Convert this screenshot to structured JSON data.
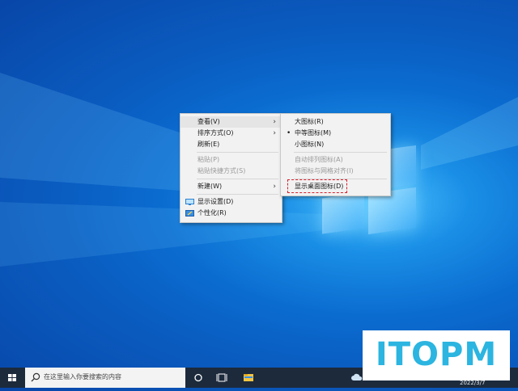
{
  "context_menu": {
    "items": [
      {
        "label": "查看(V)",
        "has_submenu": true,
        "enabled": true
      },
      {
        "label": "排序方式(O)",
        "has_submenu": true,
        "enabled": true
      },
      {
        "label": "刷新(E)",
        "enabled": true
      },
      {
        "label": "粘贴(P)",
        "enabled": false
      },
      {
        "label": "粘贴快捷方式(S)",
        "enabled": false
      },
      {
        "label": "新建(W)",
        "has_submenu": true,
        "enabled": true
      },
      {
        "label": "显示设置(D)",
        "icon": "display-icon",
        "enabled": true
      },
      {
        "label": "个性化(R)",
        "icon": "personalize-icon",
        "enabled": true
      }
    ]
  },
  "view_submenu": {
    "items": [
      {
        "label": "大图标(R)",
        "enabled": true
      },
      {
        "label": "中等图标(M)",
        "enabled": true,
        "selected": true
      },
      {
        "label": "小图标(N)",
        "enabled": true
      },
      {
        "label": "自动排列图标(A)",
        "enabled": false
      },
      {
        "label": "将图标与网格对齐(I)",
        "enabled": false
      },
      {
        "label": "显示桌面图标(D)",
        "enabled": true,
        "highlighted": true
      }
    ],
    "bullet": "•",
    "highlight_color": "#d8202a"
  },
  "taskbar": {
    "search_placeholder": "在这里输入你要搜索的内容",
    "icons": [
      "windows-start-icon",
      "search-icon",
      "cortana-circle-icon",
      "task-view-icon",
      "file-explorer-icon",
      "weather-cloud-icon"
    ],
    "clock_date": "2022/3/7"
  },
  "watermark": {
    "text": "ITOPM",
    "color": "#2bb5e0"
  },
  "colors": {
    "desktop_blue": "#0b6cd0",
    "taskbar": "#1c2a3c",
    "menu_bg": "#f2f2f2"
  }
}
